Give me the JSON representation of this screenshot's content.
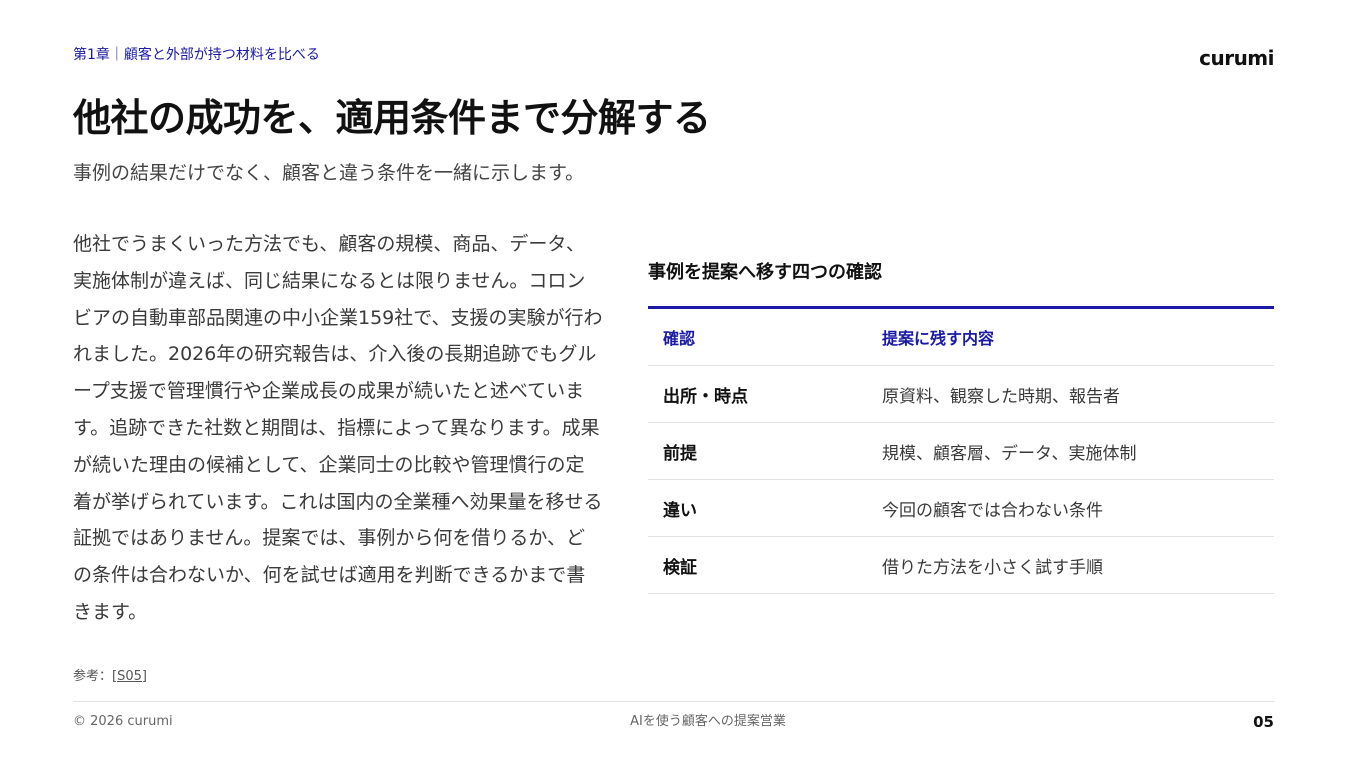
{
  "header": {
    "chapter": "第1章｜顧客と外部が持つ材料を比べる",
    "logo": "curumi"
  },
  "title": "他社の成功を、適用条件まで分解する",
  "subtitle": "事例の結果だけでなく、顧客と違う条件を一緒に示します。",
  "body": "他社でうまくいった方法でも、顧客の規模、商品、データ、実施体制が違えば、同じ結果になるとは限りません。コロンビアの自動車部品関連の中小企業159社で、支援の実験が行われました。2026年の研究報告は、介入後の長期追跡でもグループ支援で管理慣行や企業成長の成果が続いたと述べています。追跡できた社数と期間は、指標によって異なります。成果が続いた理由の候補として、企業同士の比較や管理慣行の定着が挙げられています。これは国内の全業種へ効果量を移せる証拠ではありません。提案では、事例から何を借りるか、どの条件は合わないか、何を試せば適用を判断できるかまで書きます。",
  "table": {
    "heading": "事例を提案へ移す四つの確認",
    "headers": [
      "確認",
      "提案に残す内容"
    ],
    "rows": [
      [
        "出所・時点",
        "原資料、観察した時期、報告者"
      ],
      [
        "前提",
        "規模、顧客層、データ、実施体制"
      ],
      [
        "違い",
        "今回の顧客では合わない条件"
      ],
      [
        "検証",
        "借りた方法を小さく試す手順"
      ]
    ],
    "accent_color": "#1a1aa6"
  },
  "reference": {
    "label": "参考：",
    "link": "[S05]"
  },
  "footer": {
    "copyright": "© 2026 curumi",
    "center": "AIを使う顧客への提案営業",
    "page_number": "05"
  }
}
